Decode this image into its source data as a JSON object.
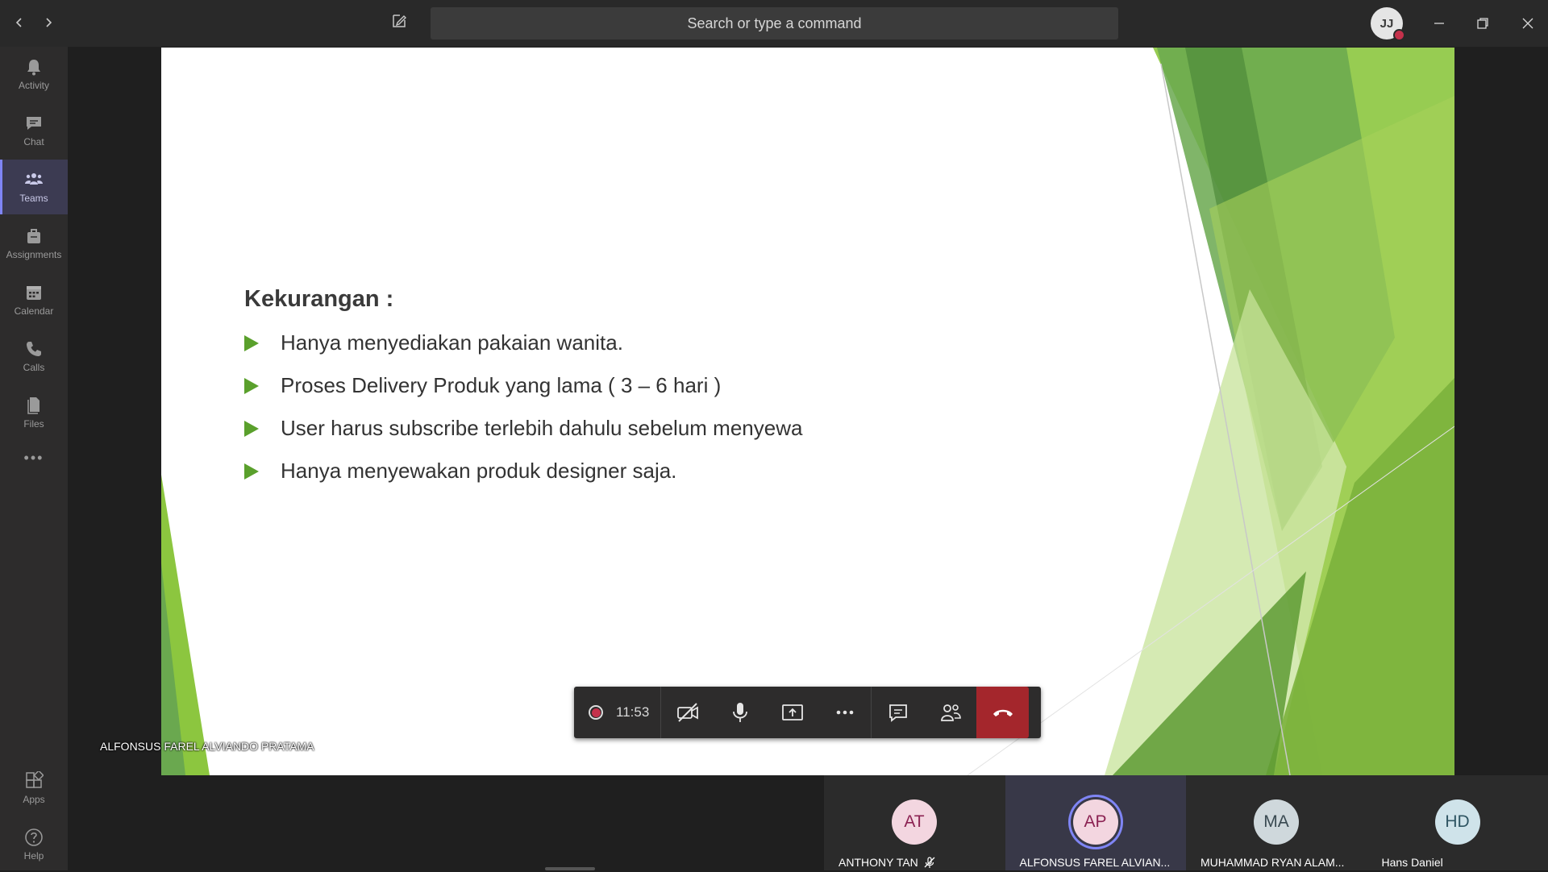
{
  "titlebar": {
    "search_placeholder": "Search or type a command",
    "user_initials": "JJ"
  },
  "rail": {
    "items": [
      {
        "label": "Activity",
        "icon": "bell-icon"
      },
      {
        "label": "Chat",
        "icon": "chat-icon"
      },
      {
        "label": "Teams",
        "icon": "teams-icon",
        "active": true
      },
      {
        "label": "Assignments",
        "icon": "briefcase-icon"
      },
      {
        "label": "Calendar",
        "icon": "calendar-icon"
      },
      {
        "label": "Calls",
        "icon": "phone-icon"
      },
      {
        "label": "Files",
        "icon": "file-icon"
      }
    ],
    "more": "•••",
    "apps_label": "Apps",
    "help_label": "Help"
  },
  "slide": {
    "title": "Kekurangan :",
    "bullets": [
      "Hanya menyediakan pakaian wanita.",
      "Proses Delivery Produk yang lama ( 3 – 6 hari )",
      "User harus subscribe terlebih dahulu sebelum menyewa",
      "Hanya menyewakan produk designer saja."
    ],
    "accent_color": "#5aa02c"
  },
  "presenter": "ALFONSUS FAREL ALVIANDO PRATAMA",
  "callbar": {
    "timer": "11:53",
    "recording_color": "#c4314b",
    "hangup_color": "#a4262c"
  },
  "participants": [
    {
      "initials": "AT",
      "name": "ANTHONY TAN",
      "bg": "#f3d6e0",
      "fg": "#8b2252",
      "muted": true
    },
    {
      "initials": "AP",
      "name": "ALFONSUS FAREL ALVIAN...",
      "bg": "#f3d6e0",
      "fg": "#8b2252",
      "speaking": true
    },
    {
      "initials": "MA",
      "name": "MUHAMMAD RYAN ALAM...",
      "bg": "#cfd8dc",
      "fg": "#3a4a52"
    },
    {
      "initials": "HD",
      "name": "Hans Daniel",
      "bg": "#cfe3ea",
      "fg": "#2f5563"
    }
  ]
}
